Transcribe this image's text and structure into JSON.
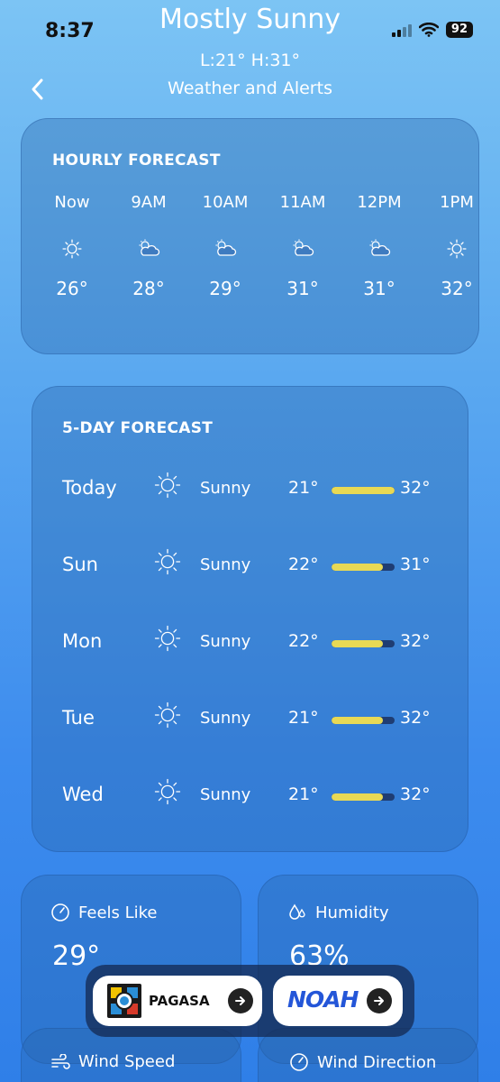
{
  "status_bar": {
    "time": "8:37",
    "battery": "92"
  },
  "header": {
    "title": "Mostly Sunny",
    "low_high": "L:21° H:31°",
    "subtitle": "Weather and Alerts"
  },
  "hourly": {
    "title": "HOURLY FORECAST",
    "items": [
      {
        "label": "Now",
        "icon": "sun-icon",
        "temp": "26°"
      },
      {
        "label": "9AM",
        "icon": "partly-cloudy-icon",
        "temp": "28°"
      },
      {
        "label": "10AM",
        "icon": "partly-cloudy-icon",
        "temp": "29°"
      },
      {
        "label": "11AM",
        "icon": "partly-cloudy-icon",
        "temp": "31°"
      },
      {
        "label": "12PM",
        "icon": "partly-cloudy-icon",
        "temp": "31°"
      },
      {
        "label": "1PM",
        "icon": "sun-icon",
        "temp": "32°"
      }
    ]
  },
  "daily": {
    "title": "5-DAY FORECAST",
    "items": [
      {
        "day": "Today",
        "icon": "sun-icon",
        "condition": "Sunny",
        "low": "21°",
        "high": "32°",
        "range_fill": 1.0
      },
      {
        "day": "Sun",
        "icon": "sun-icon",
        "condition": "Sunny",
        "low": "22°",
        "high": "31°",
        "range_fill": 0.82
      },
      {
        "day": "Mon",
        "icon": "sun-icon",
        "condition": "Sunny",
        "low": "22°",
        "high": "32°",
        "range_fill": 0.82
      },
      {
        "day": "Tue",
        "icon": "sun-icon",
        "condition": "Sunny",
        "low": "21°",
        "high": "32°",
        "range_fill": 0.82
      },
      {
        "day": "Wed",
        "icon": "sun-icon",
        "condition": "Sunny",
        "low": "21°",
        "high": "32°",
        "range_fill": 0.82
      }
    ]
  },
  "feels_like": {
    "label": "Feels Like",
    "value": "29°",
    "icon": "gauge-icon"
  },
  "humidity": {
    "label": "Humidity",
    "value": "63%",
    "icon": "droplets-icon"
  },
  "wind_speed": {
    "label": "Wind Speed",
    "icon": "wind-icon"
  },
  "wind_direction": {
    "label": "Wind Direction",
    "icon": "gauge-icon"
  },
  "links": {
    "pagasa": {
      "label": "PAGASA"
    },
    "noah": {
      "label": "NOAH"
    }
  },
  "colors": {
    "bar_fill": "#e8d955",
    "bar_track": "#1f3d73"
  }
}
